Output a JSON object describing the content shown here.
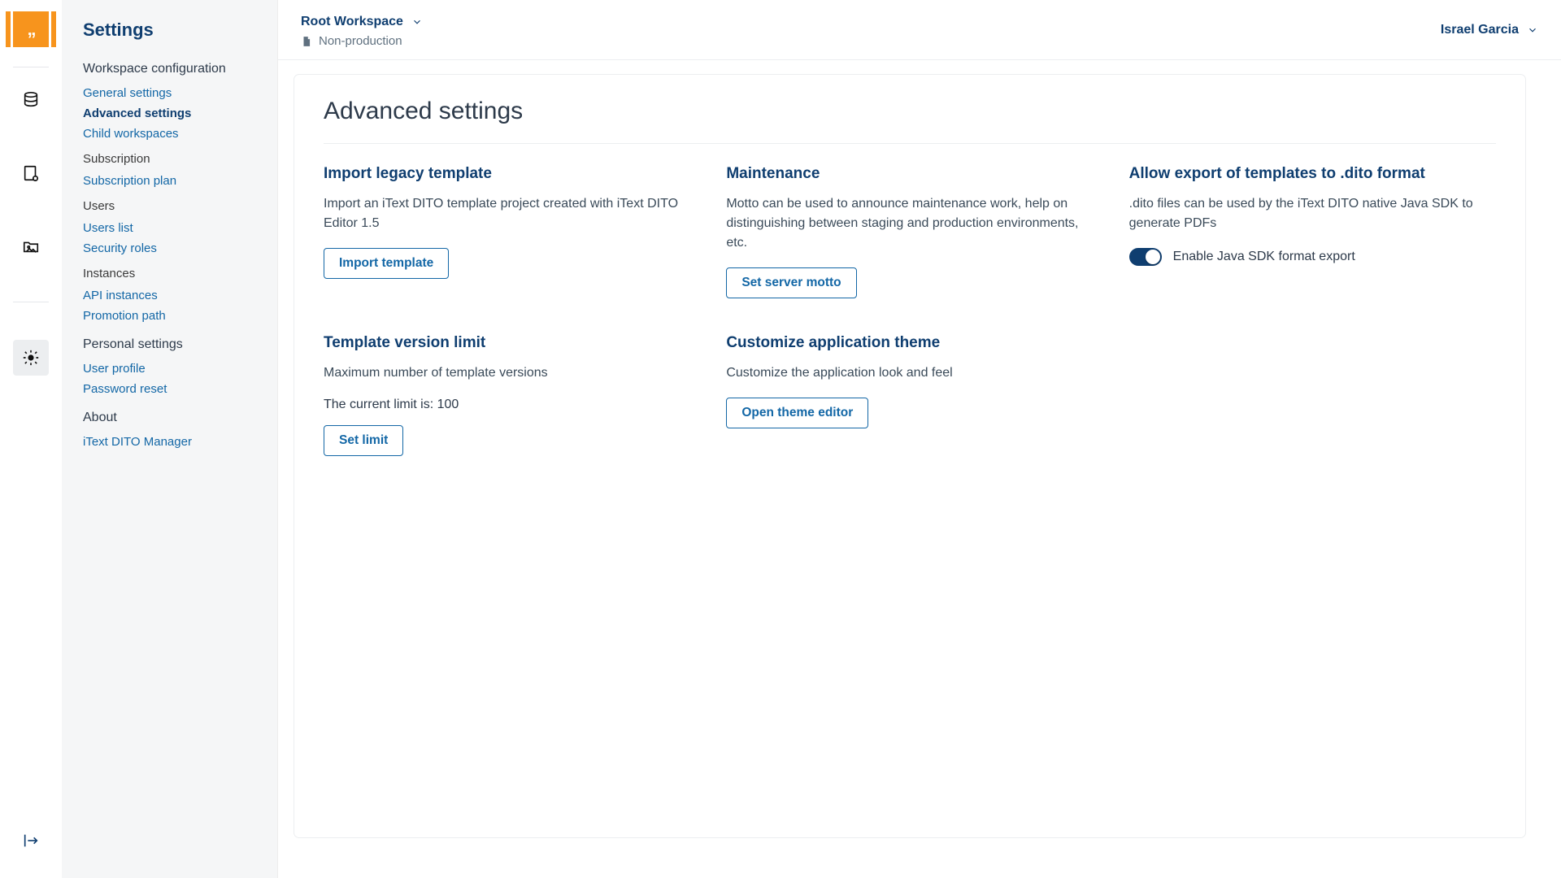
{
  "header": {
    "workspace": "Root Workspace",
    "env": "Non-production",
    "user": "Israel Garcia"
  },
  "nav": {
    "title": "Settings",
    "groups": {
      "workspace": "Workspace configuration",
      "personal": "Personal settings",
      "about": "About"
    },
    "links": {
      "general": "General settings",
      "advanced": "Advanced settings",
      "child": "Child workspaces",
      "subscription": "Subscription",
      "subscription_plan": "Subscription plan",
      "users": "Users",
      "users_list": "Users list",
      "security_roles": "Security roles",
      "instances": "Instances",
      "api_instances": "API instances",
      "promotion_path": "Promotion path",
      "user_profile": "User profile",
      "password_reset": "Password reset",
      "about_item": "iText DITO Manager"
    }
  },
  "page": {
    "title": "Advanced settings"
  },
  "sections": {
    "import": {
      "title": "Import legacy template",
      "desc": "Import an iText DITO template project created with iText DITO Editor 1.5",
      "button": "Import template"
    },
    "maintenance": {
      "title": "Maintenance",
      "desc": "Motto can be used to announce maintenance work, help on distinguishing between staging and production environments, etc.",
      "button": "Set server motto"
    },
    "export": {
      "title": "Allow export of templates to .dito format",
      "desc": ".dito files can be used by the iText DITO native Java SDK to generate PDFs",
      "toggle_label": "Enable Java SDK format export",
      "toggle_on": true
    },
    "version_limit": {
      "title": "Template version limit",
      "desc": "Maximum number of template versions",
      "current_prefix": "The current limit is: ",
      "current_value": "100",
      "button": "Set limit"
    },
    "theme": {
      "title": "Customize application theme",
      "desc": "Customize the application look and feel",
      "button": "Open theme editor"
    }
  }
}
